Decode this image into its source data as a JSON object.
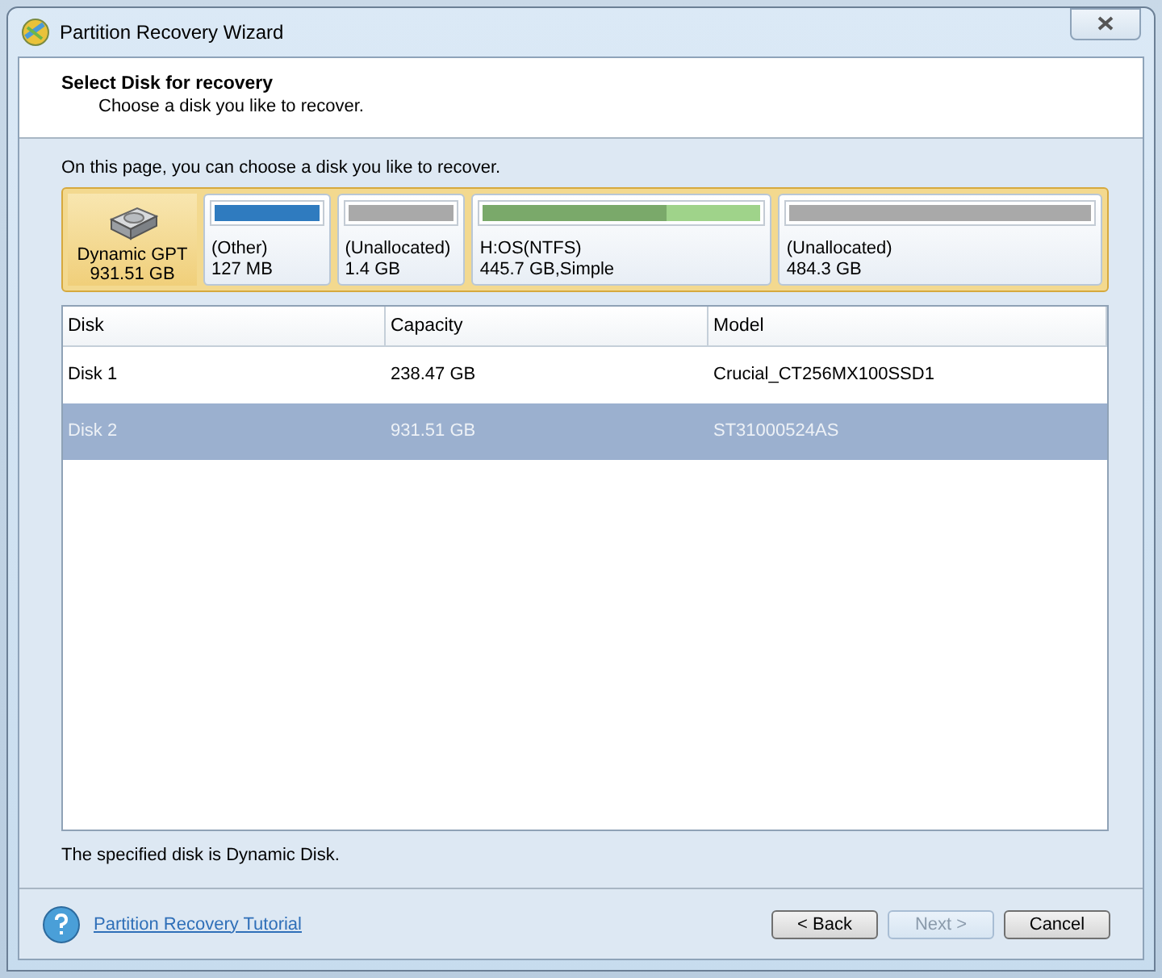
{
  "window": {
    "title": "Partition Recovery Wizard"
  },
  "header": {
    "title": "Select Disk for recovery",
    "subtitle": "Choose a disk you like to recover."
  },
  "intro": "On this page, you can choose a disk you like to recover.",
  "disk_map": {
    "disk": {
      "type": "Dynamic GPT",
      "size": "931.51 GB",
      "selected": true
    },
    "partitions": [
      {
        "label": "(Other)",
        "size": "127 MB",
        "color": "#2f7bbf"
      },
      {
        "label": "(Unallocated)",
        "size": "1.4 GB",
        "color": "#a9a9a9"
      },
      {
        "label": "H:OS(NTFS)",
        "size": "445.7 GB,Simple",
        "color": "#7aa96a",
        "level": 0.66
      },
      {
        "label": "(Unallocated)",
        "size": "484.3 GB",
        "color": "#a9a9a9"
      }
    ]
  },
  "table": {
    "columns": [
      "Disk",
      "Capacity",
      "Model"
    ],
    "rows": [
      {
        "cells": [
          "Disk 1",
          "238.47 GB",
          "Crucial_CT256MX100SSD1"
        ],
        "selected": false
      },
      {
        "cells": [
          "Disk 2",
          "931.51 GB",
          "ST31000524AS"
        ],
        "selected": true
      }
    ]
  },
  "status": "The specified disk is Dynamic Disk.",
  "footer": {
    "link": "Partition Recovery Tutorial",
    "buttons": [
      {
        "label": "< Back",
        "disabled": false
      },
      {
        "label": "Next >",
        "disabled": true
      },
      {
        "label": "Cancel",
        "disabled": false
      }
    ]
  }
}
